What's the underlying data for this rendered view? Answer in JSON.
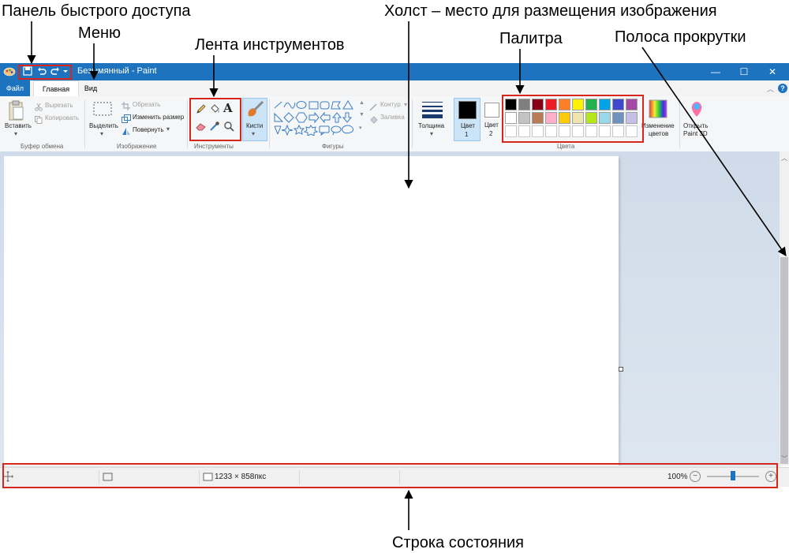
{
  "callouts": {
    "quick_access": "Панель быстрого доступа",
    "menu": "Меню",
    "ribbon": "Лента инструментов",
    "canvas": "Холст – место для размещения изображения",
    "palette": "Палитра",
    "scrollbar": "Полоса прокрутки",
    "statusbar": "Строка состояния"
  },
  "window": {
    "title": "Безымянный - Paint",
    "minimize": "—",
    "maximize": "☐",
    "close": "✕"
  },
  "menu": {
    "file": "Файл",
    "home": "Главная",
    "view": "Вид"
  },
  "ribbon": {
    "clipboard": {
      "paste": "Вставить",
      "cut": "Вырезать",
      "copy": "Копировать",
      "group": "Буфер обмена"
    },
    "image": {
      "select": "Выделить",
      "crop": "Обрезать",
      "resize": "Изменить размер",
      "rotate": "Повернуть",
      "group": "Изображение"
    },
    "tools": {
      "group": "Инструменты"
    },
    "brushes": {
      "label": "Кисти"
    },
    "shapes": {
      "outline": "Контур",
      "fill": "Заливка",
      "group": "Фигуры"
    },
    "size": {
      "label": "Толщина"
    },
    "colors": {
      "color1": "Цвет",
      "color1_num": "1",
      "color2": "Цвет",
      "color2_num": "2",
      "edit": "Изменение цветов",
      "edit_line1": "Изменение",
      "edit_line2": "цветов",
      "group": "Цвета"
    },
    "paint3d": {
      "line1": "Открыть",
      "line2": "Paint 3D"
    }
  },
  "palette": {
    "row1": [
      "#000000",
      "#7f7f7f",
      "#880015",
      "#ed1c24",
      "#ff7f27",
      "#fff200",
      "#22b14c",
      "#00a2e8",
      "#3f48cc",
      "#a349a4"
    ],
    "row2": [
      "#ffffff",
      "#c3c3c3",
      "#b97a57",
      "#ffaec9",
      "#ffc90e",
      "#efe4b0",
      "#b5e61d",
      "#99d9ea",
      "#7092be",
      "#c8bfe7"
    ],
    "row3": [
      "#ffffff",
      "#ffffff",
      "#ffffff",
      "#ffffff",
      "#ffffff",
      "#ffffff",
      "#ffffff",
      "#ffffff",
      "#ffffff",
      "#ffffff"
    ]
  },
  "status": {
    "canvas_size": "1233 × 858пкс",
    "zoom": "100%",
    "zoom_level": 1.0
  }
}
